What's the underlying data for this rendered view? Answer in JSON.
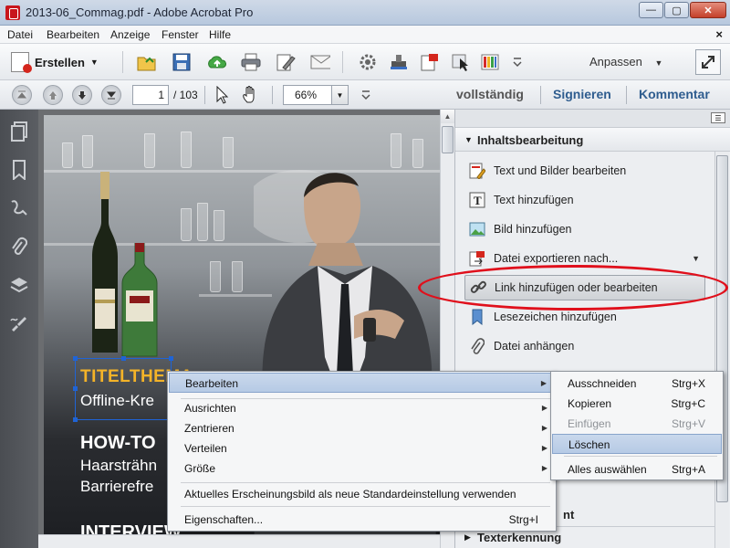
{
  "window": {
    "title": "2013-06_Commag.pdf - Adobe Acrobat Pro",
    "minimize_label": "—",
    "maximize_label": "▢",
    "close_label": "✕"
  },
  "menubar": {
    "items": [
      "Datei",
      "Bearbeiten",
      "Anzeige",
      "Fenster",
      "Hilfe"
    ],
    "close_label": "×"
  },
  "toolbar1": {
    "create_label": "Erstellen",
    "customize_label": "Anpassen",
    "icons": [
      "open-folder-icon",
      "save-icon",
      "cloud-upload-icon",
      "print-icon",
      "edit-document-icon",
      "email-icon",
      "settings-icon",
      "stamp-icon",
      "pdf-export-icon",
      "select-cursor-icon",
      "color-chart-icon"
    ]
  },
  "toolbar2": {
    "page_current": "1",
    "page_total": "/ 103",
    "zoom": "66%",
    "view_mode": "vollständig",
    "sign_label": "Signieren",
    "comment_label": "Kommentar"
  },
  "document": {
    "title_orange": "TITELTHEMA",
    "line_offline": "Offline-Kre",
    "howto_heading": "HOW-TO",
    "line_haarstr": "Haarsträhn",
    "line_barriere": "Barrierefre",
    "interview_heading": "INTERVIEW"
  },
  "rightpanel": {
    "section_title": "Inhaltsbearbeitung",
    "tools": [
      {
        "label": "Text und Bilder bearbeiten",
        "icon": "edit-text-image-icon"
      },
      {
        "label": "Text hinzufügen",
        "icon": "add-text-icon"
      },
      {
        "label": "Bild hinzufügen",
        "icon": "add-image-icon"
      },
      {
        "label": "Datei exportieren nach...",
        "icon": "export-file-icon"
      },
      {
        "label": "Link hinzufügen oder bearbeiten",
        "icon": "link-icon"
      },
      {
        "label": "Lesezeichen hinzufügen",
        "icon": "bookmark-icon"
      },
      {
        "label": "Datei anhängen",
        "icon": "attach-file-icon"
      }
    ],
    "bottom_section_partial": "nt",
    "bottom_section_2": "Texterkennung"
  },
  "context_menu": {
    "items": [
      {
        "label": "Bearbeiten",
        "submenu": true,
        "highlighted": true
      },
      {
        "label": "Ausrichten",
        "submenu": true
      },
      {
        "label": "Zentrieren",
        "submenu": true
      },
      {
        "label": "Verteilen",
        "submenu": true
      },
      {
        "label": "Größe",
        "submenu": true
      },
      {
        "label": "Aktuelles Erscheinungsbild als neue Standardeinstellung verwenden"
      },
      {
        "label": "Eigenschaften...",
        "shortcut": "Strg+I"
      }
    ]
  },
  "submenu": {
    "items": [
      {
        "label": "Ausschneiden",
        "shortcut": "Strg+X"
      },
      {
        "label": "Kopieren",
        "shortcut": "Strg+C"
      },
      {
        "label": "Einfügen",
        "shortcut": "Strg+V",
        "disabled": true
      },
      {
        "label": "Löschen",
        "shortcut": "",
        "highlighted": true
      },
      {
        "label": "Alles auswählen",
        "shortcut": "Strg+A"
      }
    ]
  },
  "colors": {
    "accent_blue": "#2f5d8f",
    "highlight_red": "#e0101c",
    "title_orange": "#f4b328",
    "selection_blue": "#1f64d6"
  }
}
